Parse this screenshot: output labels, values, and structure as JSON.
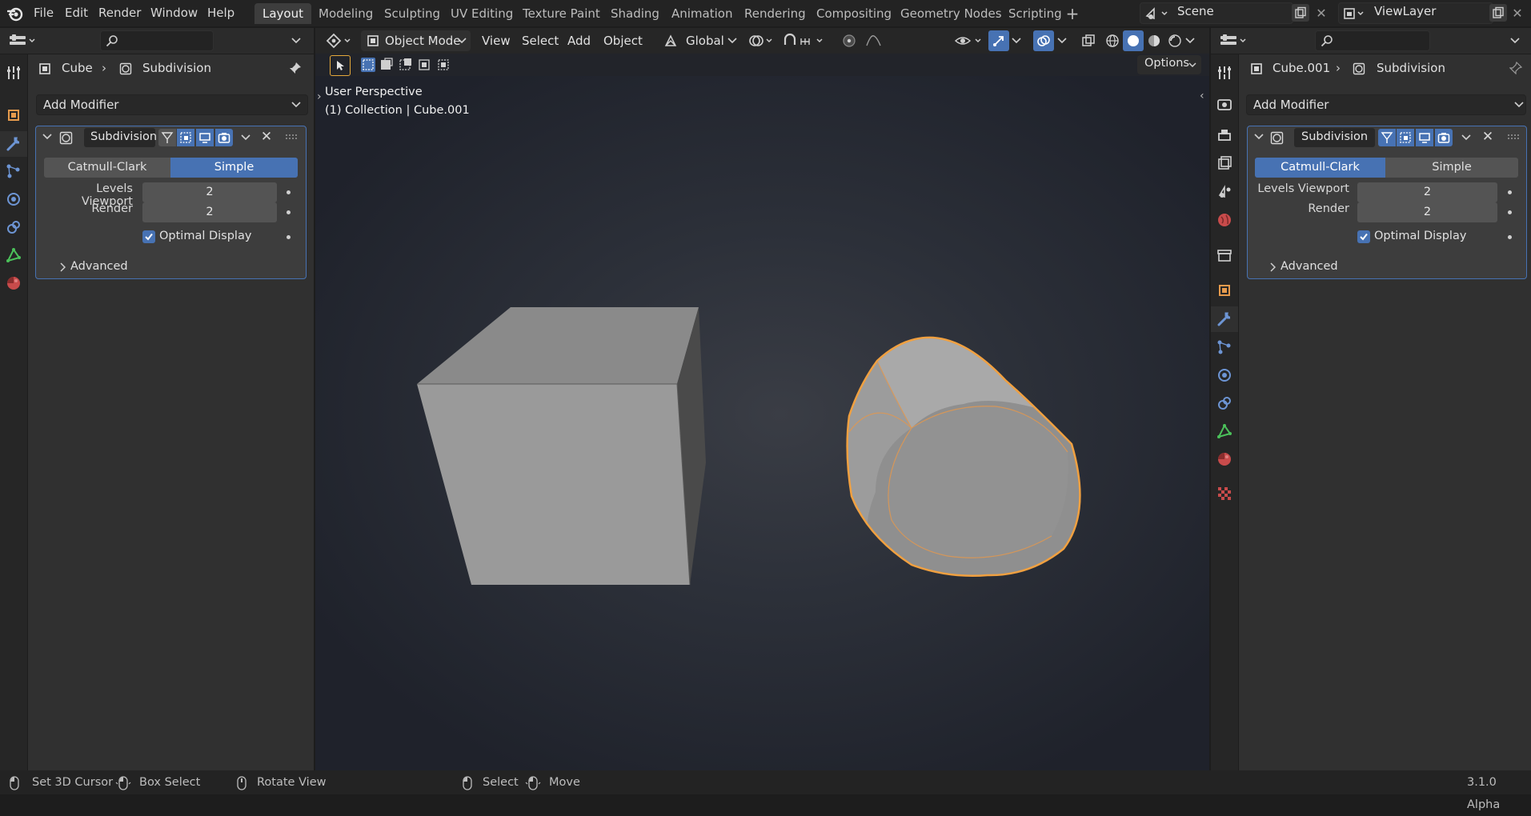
{
  "menu": {
    "file": "File",
    "edit": "Edit",
    "render": "Render",
    "window": "Window",
    "help": "Help"
  },
  "workspaces": [
    "Layout",
    "Modeling",
    "Sculpting",
    "UV Editing",
    "Texture Paint",
    "Shading",
    "Animation",
    "Rendering",
    "Compositing",
    "Geometry Nodes",
    "Scripting"
  ],
  "scene": {
    "name": "Scene",
    "view_layer": "ViewLayer"
  },
  "left_props": {
    "breadcrumb_object": "Cube",
    "breadcrumb_modifier": "Subdivision",
    "add_modifier": "Add Modifier",
    "modifier_name": "Subdivision",
    "catmull": "Catmull-Clark",
    "simple": "Simple",
    "selected_mode": "Simple",
    "levels_viewport_label": "Levels Viewport",
    "levels_viewport": "2",
    "render_label": "Render",
    "render": "2",
    "optimal_display": "Optimal Display",
    "advanced": "Advanced"
  },
  "right_props": {
    "breadcrumb_object": "Cube.001",
    "breadcrumb_modifier": "Subdivision",
    "add_modifier": "Add Modifier",
    "modifier_name": "Subdivision",
    "catmull": "Catmull-Clark",
    "simple": "Simple",
    "selected_mode": "Catmull-Clark",
    "levels_viewport_label": "Levels Viewport",
    "levels_viewport": "2",
    "render_label": "Render",
    "render": "2",
    "optimal_display": "Optimal Display",
    "advanced": "Advanced"
  },
  "viewport": {
    "mode": "Object Mode",
    "menus": {
      "view": "View",
      "select": "Select",
      "add": "Add",
      "object": "Object"
    },
    "orientation": "Global",
    "options": "Options",
    "perspective": "User Perspective",
    "collection_info": "(1) Collection | Cube.001"
  },
  "statusbar": {
    "set_cursor": "Set 3D Cursor",
    "box_select": "Box Select",
    "rotate_view": "Rotate View",
    "select": "Select",
    "move": "Move",
    "version": "3.1.0 Alpha"
  },
  "colors": {
    "accent": "#4772b3",
    "selection": "#f5a040",
    "background": "#1d1d1d"
  }
}
